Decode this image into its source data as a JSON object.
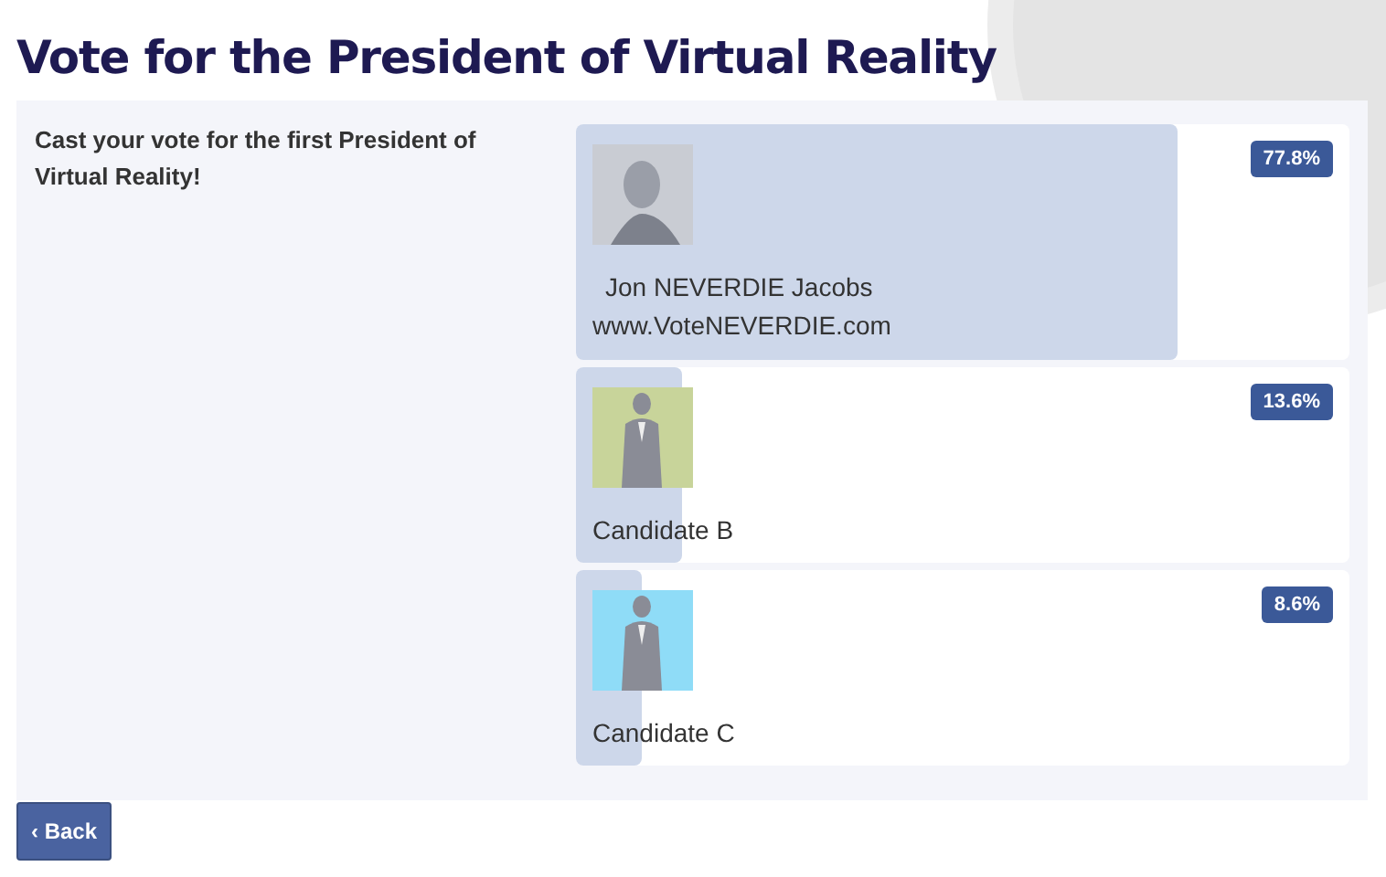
{
  "title": "Vote for the President of Virtual Reality",
  "prompt": "Cast your vote for the first President of Virtual Reality!",
  "candidates": [
    {
      "kind": "photo",
      "name": "Jon NEVERDIE Jacobs",
      "website": "www.VoteNEVERDIE.com",
      "level": 0.778,
      "percent": "77.8%"
    },
    {
      "kind": "silhouette",
      "color": "#c8d49a",
      "name": "Candidate B",
      "level": 0.136,
      "percent": "13.6%"
    },
    {
      "kind": "silhouette",
      "color": "#8fdcf7",
      "name": "Candidate C",
      "level": 0.086,
      "percent": "8.6%"
    }
  ],
  "back_button": {
    "arrow": "‹",
    "label": "Back"
  }
}
